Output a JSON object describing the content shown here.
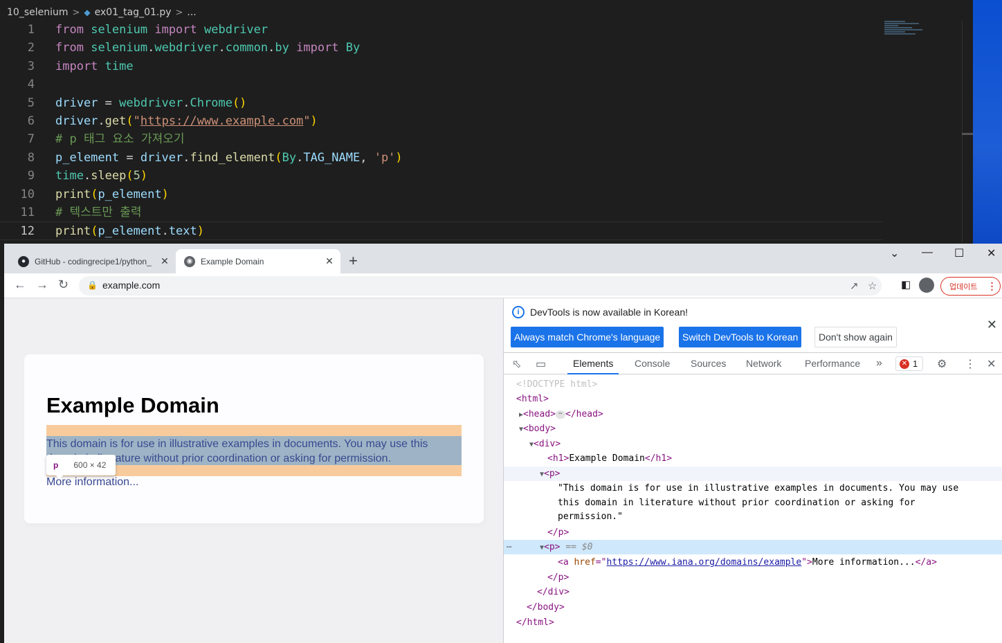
{
  "editor": {
    "breadcrumb": {
      "folder": "10_selenium",
      "file": "ex01_tag_01.py",
      "more": "..."
    },
    "current_line": 12
  },
  "browser": {
    "tabs": [
      {
        "title": "GitHub - codingrecipe1/python_"
      },
      {
        "title": "Example Domain"
      }
    ],
    "url": "example.com",
    "update_label": "업데이트"
  },
  "page": {
    "heading": "Example Domain",
    "heading_visible": "le Domain",
    "paragraph": "This domain is for use in illustrative examples in documents. You may use this domain in literature without prior coordination or asking for permission.",
    "link": "More information..."
  },
  "tooltip": {
    "tag": "p",
    "dims": "600 × 42"
  },
  "devtools": {
    "info_text": "DevTools is now available in Korean!",
    "btn_match": "Always match Chrome's language",
    "btn_switch": "Switch DevTools to Korean",
    "btn_dont": "Don't show again",
    "tabs": [
      "Elements",
      "Console",
      "Sources",
      "Network",
      "Performance"
    ],
    "error_count": "1",
    "dom": {
      "doctype": "<!DOCTYPE html>",
      "p_text_1": "\"This domain is for use in illustrative examples in documents. You may use",
      "p_text_2": "this domain in literature without prior coordination or asking for",
      "p_text_3": "permission.\"",
      "h1_text": "Example Domain",
      "href": "https://www.iana.org/domains/example",
      "link_text": "More information...",
      "selected_marker": "== $0"
    }
  },
  "colors": {
    "accent": "#1a73e8",
    "editor_bg": "#1e1e1e",
    "highlight_content": "#6fa8dc",
    "highlight_margin": "#f6b26b"
  }
}
